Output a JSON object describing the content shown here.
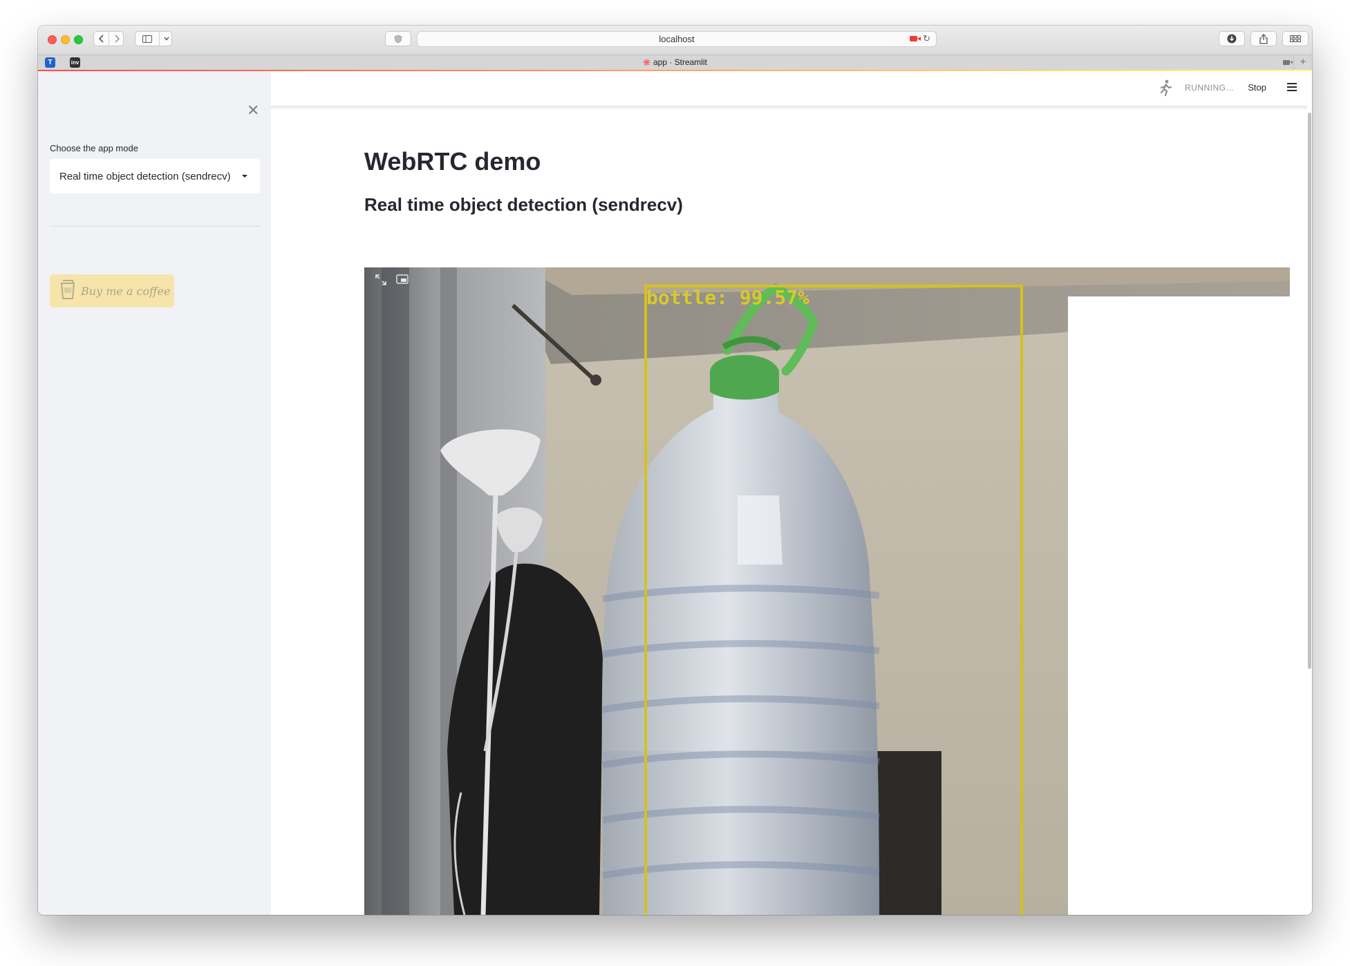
{
  "browser": {
    "url": "localhost",
    "tab_title": "app · Streamlit",
    "pinned_tabs": [
      "T",
      "inv"
    ]
  },
  "app": {
    "status": "RUNNING...",
    "stop_label": "Stop",
    "sidebar": {
      "select_label": "Choose the app mode",
      "select_value": "Real time object detection (sendrecv)",
      "coffee_label": "Buy me a coffee"
    },
    "main": {
      "title": "WebRTC demo",
      "subtitle": "Real time object detection (sendrecv)",
      "video": {
        "detection_label": "bottle: 99.57%",
        "detection_color": "#d4c21f",
        "detection_class": "bottle",
        "confidence": 99.57
      }
    }
  },
  "colors": {
    "accent": "#ff4b4b",
    "sidebar_bg": "#f0f2f6",
    "coffee_bg": "#f7e4ab",
    "text": "#262730"
  },
  "icons": [
    "back-icon",
    "forward-icon",
    "sidebar-icon",
    "shield-icon",
    "camera-icon",
    "reload-icon",
    "download-icon",
    "share-icon",
    "tabs-icon",
    "close-icon",
    "running-icon",
    "menu-icon",
    "fullscreen-icon",
    "picture-in-picture-icon",
    "coffee-cup-icon"
  ]
}
